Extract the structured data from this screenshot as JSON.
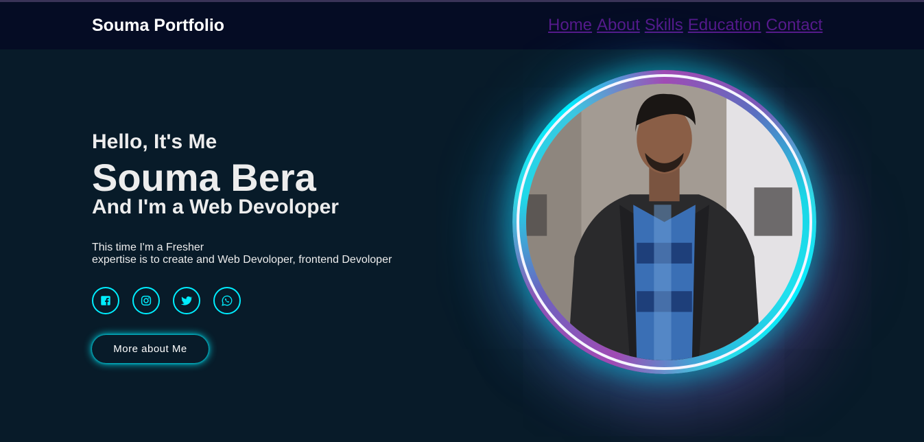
{
  "header": {
    "logo": "Souma Portfolio",
    "nav": [
      "Home",
      "About",
      "Skills",
      "Education",
      "Contact"
    ]
  },
  "hero": {
    "greeting": "Hello, It's Me",
    "name": "Souma Bera",
    "role": "And I'm a Web Devoloper",
    "description_line1": "This time I'm a Fresher",
    "description_line2": "expertise is to create and Web Devoloper, frontend Devoloper",
    "button_label": "More about Me",
    "socials": [
      "facebook-icon",
      "instagram-icon",
      "twitter-icon",
      "whatsapp-icon"
    ]
  },
  "colors": {
    "background": "#081b29",
    "header_bg": "#050c24",
    "accent": "#00eeff",
    "nav_link": "#551a8b",
    "text": "#ededed"
  }
}
